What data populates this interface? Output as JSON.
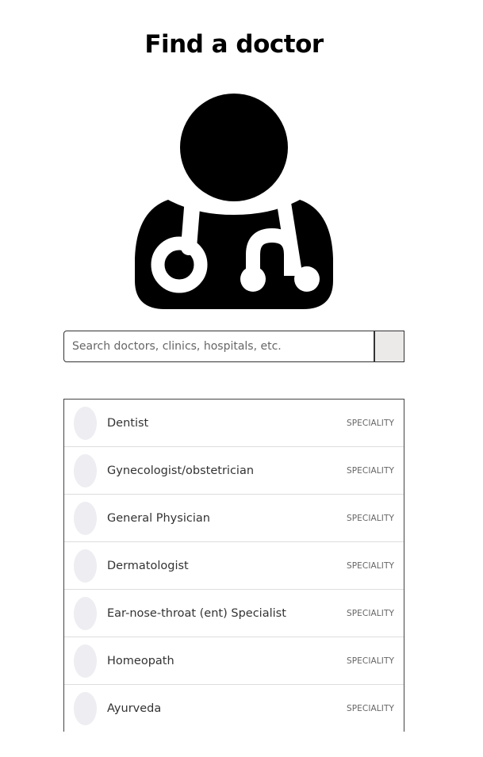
{
  "page": {
    "title": "Find a doctor"
  },
  "hero": {
    "icon": "doctor-stethoscope-icon"
  },
  "search": {
    "placeholder": "Search doctors, clinics, hospitals, etc.",
    "value": "",
    "button_icon": "search-button"
  },
  "results": {
    "items": [
      {
        "label": "Dentist",
        "tag": "SPECIALITY"
      },
      {
        "label": "Gynecologist/obstetrician",
        "tag": "SPECIALITY"
      },
      {
        "label": "General Physician",
        "tag": "SPECIALITY"
      },
      {
        "label": "Dermatologist",
        "tag": "SPECIALITY"
      },
      {
        "label": "Ear-nose-throat (ent) Specialist",
        "tag": "SPECIALITY"
      },
      {
        "label": "Homeopath",
        "tag": "SPECIALITY"
      },
      {
        "label": "Ayurveda",
        "tag": "SPECIALITY"
      }
    ]
  },
  "colors": {
    "avatar_bg": "#ededf2",
    "button_bg": "#ece9e9",
    "icon": "#000000"
  }
}
